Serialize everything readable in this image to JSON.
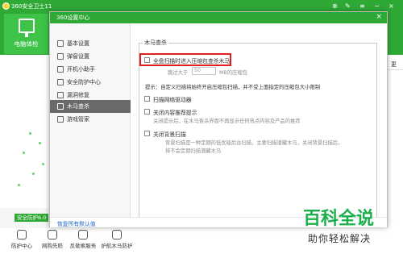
{
  "main": {
    "title": "360安全卫士11",
    "nav_checkup_label": "电脑体检",
    "right_strip_label": "更",
    "version_badge": "安全防护6.0",
    "bottom_items": [
      "防护中心",
      "网购先赔",
      "反勒索服务",
      "护航木马防护"
    ]
  },
  "dialog": {
    "title": "360设置中心",
    "sidebar": [
      {
        "label": "基本设置",
        "icon": "gear-icon"
      },
      {
        "label": "弹窗设置",
        "icon": "popup-icon"
      },
      {
        "label": "开机小助手",
        "icon": "power-icon"
      },
      {
        "label": "安全防护中心",
        "icon": "shield-icon"
      },
      {
        "label": "漏洞修复",
        "icon": "bug-icon"
      },
      {
        "label": "木马查杀",
        "icon": "trojan-icon",
        "active": true
      },
      {
        "label": "游戏管家",
        "icon": "gamepad-icon"
      }
    ],
    "group_title": "木马查杀",
    "opt_compressed": {
      "label": "全盘扫描时进入压缩包查杀木马",
      "skip_prefix": "跳过大于",
      "skip_value": "50",
      "skip_suffix": "MB的压缩包"
    },
    "hint": "提示：自定义扫描将始终开启压缩包扫描，并不受上面指定的压缩包大小限制",
    "opt_driver": "扫描网络驱动器",
    "opt_content": {
      "label": "关闭内容推荐提示",
      "desc": "关闭提示后，在木马查杀界面不再显示任何热点内容及产品的推荐"
    },
    "opt_background": {
      "label": "关闭背景扫描",
      "desc_line1": "背景扫描是一种定期的低优级后台扫描，主要扫描潜藏木马，关闭背景扫描后，",
      "desc_line2": "将不会定期扫描潜藏木马"
    },
    "footer_link": "恢复所有默认值"
  },
  "watermark": {
    "line1": "百科全说",
    "line2": "助你轻松解决"
  },
  "colors": {
    "brand_green": "#2fa936",
    "highlight_red": "#e01e1e",
    "sidebar_active": "#6a6a6a",
    "link_blue": "#1a66c9"
  }
}
